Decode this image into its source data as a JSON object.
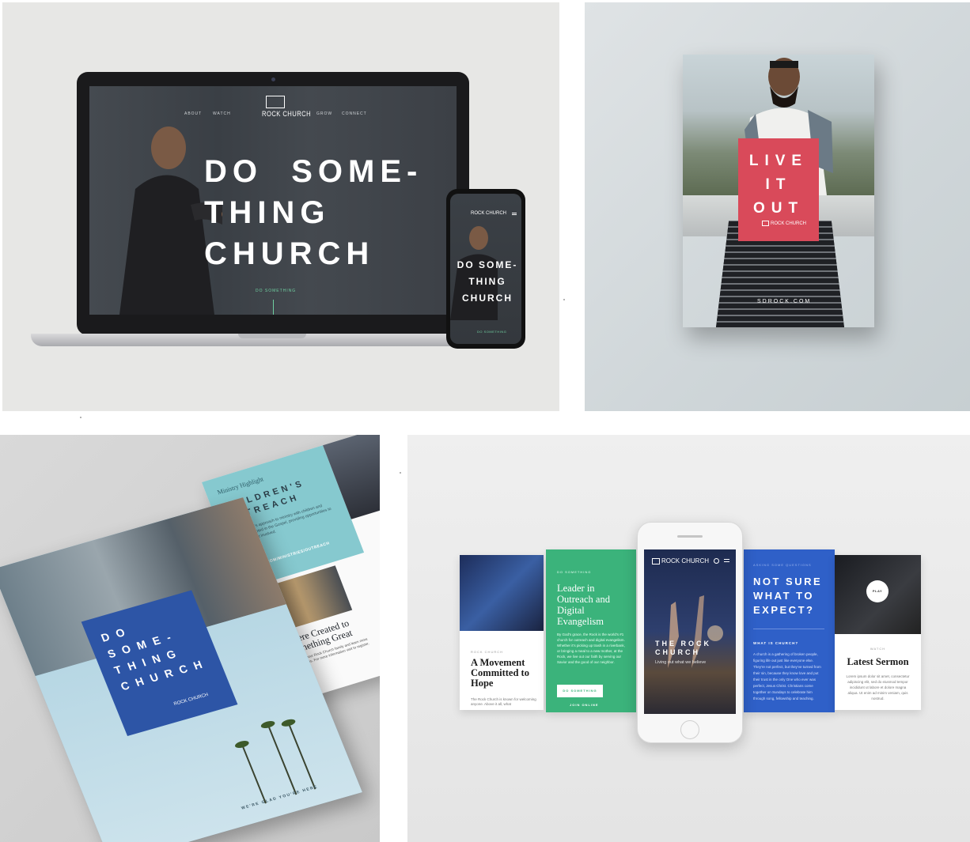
{
  "laptop": {
    "nav_left": [
      "ABOUT",
      "WATCH"
    ],
    "nav_right": [
      "GROW",
      "CONNECT"
    ],
    "logo": "ROCK CHURCH",
    "hero": "DO  SOME-\nTHING\nCHURCH",
    "cta": "DO SOMETHING"
  },
  "phone": {
    "logo": "ROCK CHURCH",
    "hero": "DO\nSOME-\nTHING\nCHURCH",
    "cta": "DO SOMETHING"
  },
  "poster": {
    "headline": "LIVE\nIT\nOUT",
    "logo": "ROCK CHURCH",
    "url": "SDROCK.COM"
  },
  "brochure_back": {
    "kicker": "Ministry Highlight",
    "headline": "CHILDREN'S\nOUTREACH",
    "body": "Rock Church's approach to ministry with children and families is rooted in the Gospel, providing opportunities to serve and get involved.",
    "url": "SDROCK.COM/MINISTRIES/OUTREACH",
    "story_title": "You Were Created to\nDo Something Great",
    "story_body": "Get plugged into your Rock Church family and learn more about our ministries. For more information visit to register."
  },
  "brochure_front": {
    "headline": "DO\nSOME-\nTHING\nCHURCH",
    "logo": "ROCK CHURCH",
    "tagline": "WE'RE GLAD YOU'RE HERE"
  },
  "mobile_cards": {
    "card1": {
      "label": "ROCK CHURCH",
      "title": "A Movement\nCommitted to\nHope",
      "body": "The Rock Church is known for welcoming anyone. Above it all, what"
    },
    "card2": {
      "label": "DO SOMETHING",
      "title": "Leader in\nOutreach and\nDigital\nEvangelism",
      "body": "By God's grace, the Rock is the world's #1 church for outreach and digital evangelism. Whether it's picking up trash in a riverbank, or bringing a meal to a new mother, at the Rock, we live out our faith by serving our Savior and the good of our neighbor.",
      "button": "DO SOMETHING",
      "link": "JOIN ONLINE"
    },
    "phone": {
      "logo": "ROCK CHURCH",
      "title": "THE ROCK\nCHURCH",
      "subtitle": "Living out what we believe"
    },
    "card4": {
      "label": "ASKING SOME QUESTIONS",
      "title": "NOT SURE\nWHAT TO\nEXPECT?",
      "question": "WHAT IS CHURCH?",
      "body": "A church is a gathering of broken people, figuring life out just like everyone else. They're not perfect, but they've turned from their sin, because they know love and put their trust in the only One who ever was perfect, Jesus Christ. Christians come together on Sundays to celebrate him through song, fellowship and teaching."
    },
    "card5": {
      "play": "PLAY",
      "label": "WATCH",
      "title": "Latest Sermon",
      "body": "Lorem ipsum dolor sit amet, consectetur adipiscing elit, sed do eiusmod tempor incididunt ut labore et dolore magna aliqua. Ut enim ad minim veniam, quis nostrud."
    }
  }
}
